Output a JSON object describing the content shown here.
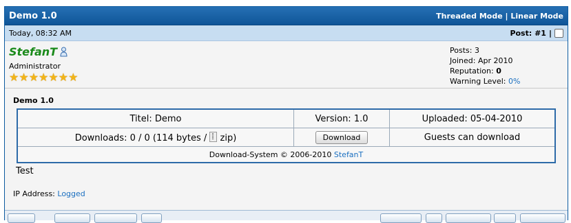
{
  "header": {
    "title": "Demo 1.0",
    "threaded_mode": "Threaded Mode",
    "separator": "|",
    "linear_mode": "Linear Mode"
  },
  "post_bar": {
    "date": "Today, 08:32 AM",
    "post_label": "Post: #1",
    "separator": "|"
  },
  "user": {
    "name": "StefanT",
    "rank": "Administrator",
    "stars": 7,
    "star_glyph": "★",
    "stats": {
      "posts_label": "Posts:",
      "posts_value": "3",
      "joined_label": "Joined:",
      "joined_value": "Apr 2010",
      "reputation_label": "Reputation:",
      "reputation_value": "0",
      "warning_label": "Warning Level:",
      "warning_value": "0%"
    }
  },
  "post": {
    "title": "Demo 1.0",
    "download_table": {
      "titel": "Titel: Demo",
      "version": "Version: 1.0",
      "uploaded": "Uploaded: 05-04-2010",
      "downloads_prefix": "Downloads: 0 / 0 (114 bytes /",
      "downloads_suffix": "zip)",
      "download_button": "Download",
      "guests": "Guests can download",
      "copyright": "Download-System © 2006-2010",
      "copyright_author": "StefanT"
    },
    "message": "Test",
    "ip_label": "IP Address:",
    "ip_value": "Logged"
  },
  "colors": {
    "header_bg": "#1a64aa",
    "subheader_bg": "#c7ddf1",
    "username": "#1a8a1a",
    "link": "#1a6fc0",
    "star": "#f2b418"
  },
  "icons": {
    "user": "user-status-icon",
    "zip": "zip-file-icon"
  }
}
